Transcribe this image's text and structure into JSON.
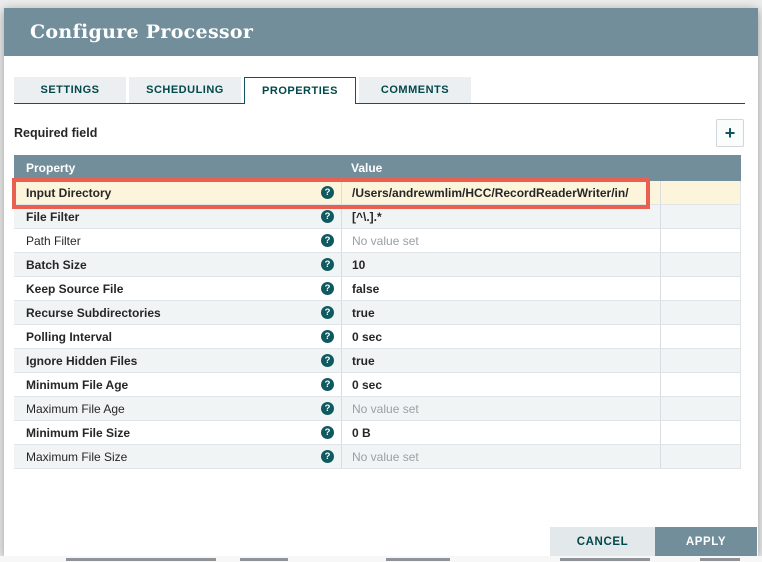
{
  "dialog": {
    "title": "Configure Processor"
  },
  "tabs": [
    {
      "label": "SETTINGS",
      "active": false
    },
    {
      "label": "SCHEDULING",
      "active": false
    },
    {
      "label": "PROPERTIES",
      "active": true
    },
    {
      "label": "COMMENTS",
      "active": false
    }
  ],
  "properties_panel": {
    "required_field_label": "Required field",
    "add_button_icon": "+"
  },
  "table": {
    "columns": [
      "Property",
      "Value"
    ],
    "help_icon": "?",
    "rows": [
      {
        "property": "Input Directory",
        "required": true,
        "value": "/Users/andrewmlim/HCC/RecordReaderWriter/in/",
        "value_set": true,
        "highlighted": true
      },
      {
        "property": "File Filter",
        "required": true,
        "value": "[^\\.].*",
        "value_set": true,
        "highlighted": false
      },
      {
        "property": "Path Filter",
        "required": false,
        "value": "No value set",
        "value_set": false,
        "highlighted": false
      },
      {
        "property": "Batch Size",
        "required": true,
        "value": "10",
        "value_set": true,
        "highlighted": false
      },
      {
        "property": "Keep Source File",
        "required": true,
        "value": "false",
        "value_set": true,
        "highlighted": false
      },
      {
        "property": "Recurse Subdirectories",
        "required": true,
        "value": "true",
        "value_set": true,
        "highlighted": false
      },
      {
        "property": "Polling Interval",
        "required": true,
        "value": "0 sec",
        "value_set": true,
        "highlighted": false
      },
      {
        "property": "Ignore Hidden Files",
        "required": true,
        "value": "true",
        "value_set": true,
        "highlighted": false
      },
      {
        "property": "Minimum File Age",
        "required": true,
        "value": "0 sec",
        "value_set": true,
        "highlighted": false
      },
      {
        "property": "Maximum File Age",
        "required": false,
        "value": "No value set",
        "value_set": false,
        "highlighted": false
      },
      {
        "property": "Minimum File Size",
        "required": true,
        "value": "0 B",
        "value_set": true,
        "highlighted": false
      },
      {
        "property": "Maximum File Size",
        "required": false,
        "value": "No value set",
        "value_set": false,
        "highlighted": false
      }
    ]
  },
  "footer": {
    "cancel_label": "CANCEL",
    "apply_label": "APPLY"
  },
  "colors": {
    "header_bg": "#728e9b",
    "accent_teal": "#004849",
    "highlight_border": "#ea6050",
    "highlight_row_bg": "#fcf5dc",
    "row_alt_bg": "#f1f4f5"
  }
}
